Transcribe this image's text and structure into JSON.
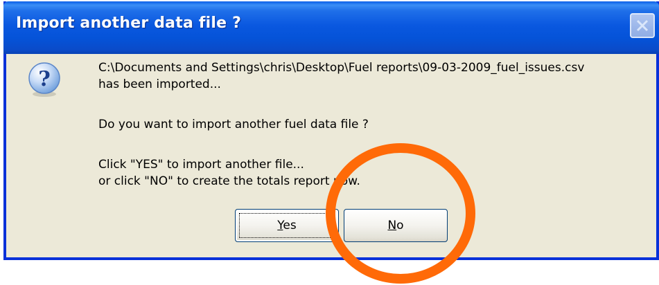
{
  "window": {
    "title": "Import another data file ?"
  },
  "message": {
    "line1": "C:\\Documents and Settings\\chris\\Desktop\\Fuel reports\\09-03-2009_fuel_issues.csv",
    "line2": " has been imported...",
    "line3": "Do you want to import another fuel data file ?",
    "line4": "Click \"YES\" to import another file...",
    "line5": "or click \"NO\" to create the totals report now."
  },
  "buttons": {
    "yes_first": "Y",
    "yes_rest": "es",
    "no_first": "N",
    "no_rest": "o"
  },
  "icons": {
    "question": "question-icon",
    "close": "close-icon"
  },
  "colors": {
    "titlebar": "#0553d8",
    "dialog_bg": "#ece9d8",
    "annotation": "#ff6a08"
  }
}
